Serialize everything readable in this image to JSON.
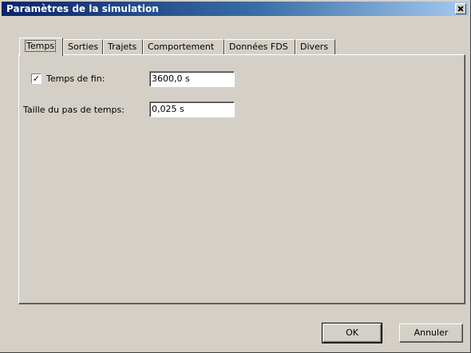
{
  "window": {
    "title": "Paramètres de la simulation"
  },
  "tabs": [
    {
      "label": "Temps"
    },
    {
      "label": "Sorties"
    },
    {
      "label": "Trajets"
    },
    {
      "label": "Comportement"
    },
    {
      "label": "Données FDS"
    },
    {
      "label": "Divers"
    }
  ],
  "active_tab": "Temps",
  "form": {
    "end_time": {
      "checked": true,
      "check_glyph": "✓",
      "label": "Temps de fin:",
      "value": "3600,0 s"
    },
    "time_step": {
      "label": "Taille du pas de temps:",
      "value": "0,025 s"
    }
  },
  "buttons": {
    "ok": "OK",
    "cancel": "Annuler"
  }
}
